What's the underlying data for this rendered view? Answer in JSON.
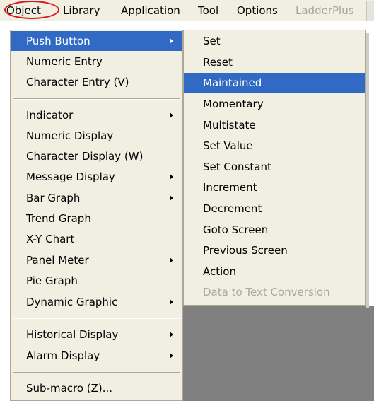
{
  "menubar": {
    "items": [
      {
        "label": "Object"
      },
      {
        "label": "Library"
      },
      {
        "label": "Application"
      },
      {
        "label": "Tool"
      },
      {
        "label": "Options"
      },
      {
        "label": "LadderPlus",
        "disabled": true
      }
    ],
    "highlight_color": "#d8141b"
  },
  "object_menu": {
    "items": [
      {
        "label": "Push Button",
        "submenu": true,
        "selected": true
      },
      {
        "label": "Numeric Entry"
      },
      {
        "label": "Character Entry (V)"
      },
      {
        "label": "Indicator",
        "submenu": true
      },
      {
        "label": "Numeric Display"
      },
      {
        "label": "Character Display (W)"
      },
      {
        "label": "Message Display",
        "submenu": true
      },
      {
        "label": "Bar Graph",
        "submenu": true
      },
      {
        "label": "Trend Graph"
      },
      {
        "label": "X-Y Chart"
      },
      {
        "label": "Panel Meter",
        "submenu": true
      },
      {
        "label": "Pie Graph"
      },
      {
        "label": "Dynamic Graphic",
        "submenu": true
      },
      {
        "label": "Historical Display",
        "submenu": true
      },
      {
        "label": "Alarm Display",
        "submenu": true
      },
      {
        "label": "Sub-macro (Z)..."
      }
    ]
  },
  "push_button_menu": {
    "items": [
      {
        "label": "Set"
      },
      {
        "label": "Reset"
      },
      {
        "label": "Maintained",
        "selected": true
      },
      {
        "label": "Momentary"
      },
      {
        "label": "Multistate"
      },
      {
        "label": "Set Value"
      },
      {
        "label": "Set Constant"
      },
      {
        "label": "Increment"
      },
      {
        "label": "Decrement"
      },
      {
        "label": "Goto Screen"
      },
      {
        "label": "Previous Screen"
      },
      {
        "label": "Action"
      },
      {
        "label": "Data to Text Conversion",
        "disabled": true
      }
    ]
  },
  "colors": {
    "menu_bg": "#f1efe2",
    "selection": "#316ac5",
    "disabled_text": "#aca899",
    "workspace": "#808080"
  }
}
